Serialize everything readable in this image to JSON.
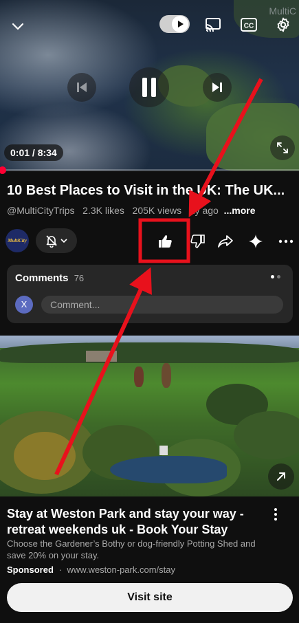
{
  "player": {
    "watermark": "MultiC",
    "time": "0:01 / 8:34",
    "progress_fraction": 0.002
  },
  "video": {
    "title": "10 Best Places to Visit in the UK: The UK...",
    "channel": "@MultiCityTrips",
    "likes": "2.3K likes",
    "views": "205K views",
    "age": "1y ago",
    "more": "...more",
    "channel_avatar_text": "MultiCity"
  },
  "comments": {
    "label": "Comments",
    "count": "76",
    "avatar_letter": "X",
    "placeholder": "Comment..."
  },
  "ad": {
    "title": "Stay at Weston Park and stay your way - retreat weekends uk - Book Your Stay",
    "description": "Choose the Gardener’s Bothy or dog-friendly Potting Shed and save 20% on your stay.",
    "sponsored": "Sponsored",
    "separator": "·",
    "url": "www.weston-park.com/stay",
    "cta": "Visit site"
  },
  "colors": {
    "accent_red": "#ff0033",
    "annotation_red": "#e8111c",
    "background": "#0f0f0f"
  }
}
